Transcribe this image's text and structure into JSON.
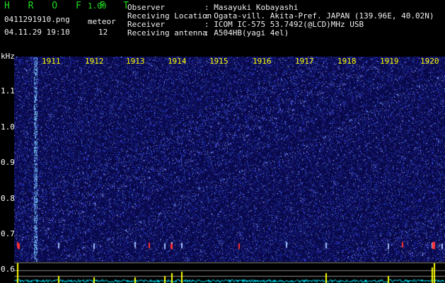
{
  "app": {
    "title": "H R O F F T",
    "version": "1.00"
  },
  "file": {
    "name": "0411291910.png",
    "datetime": "04.11.29 19:10"
  },
  "meteor": {
    "label": "meteor",
    "count": "12"
  },
  "info": [
    {
      "label": "Observer",
      "value": ": Masayuki Kobayashi"
    },
    {
      "label": "Receiving Location",
      "value": ": Ogata-vill. Akita-Pref. JAPAN (139.96E, 40.02N)"
    },
    {
      "label": "Receiver",
      "value": ": ICOM IC-575 53.7492(@LCD)MHz USB"
    },
    {
      "label": "Receiving antenna",
      "value": ": A504HB(yagi 4el)"
    }
  ],
  "axis": {
    "unit": "kHz",
    "y_ticks": [
      "1.1",
      "1.0",
      "0.9",
      "0.8",
      "0.7",
      "0.6"
    ],
    "x_ticks": [
      "1911",
      "1912",
      "1913",
      "1914",
      "1915",
      "1916",
      "1917",
      "1918",
      "1919",
      "1920"
    ]
  },
  "colors": {
    "background": "#08085a",
    "dots": "#3b50ff",
    "ticks_x": "#ffff00",
    "signal": "#ff3333",
    "level_line": "#00e5ff",
    "level_peak": "#ffff00"
  }
}
